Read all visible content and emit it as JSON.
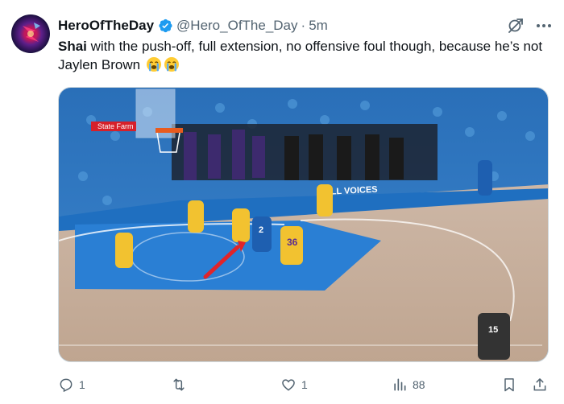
{
  "tweet": {
    "author": {
      "display_name": "HeroOfTheDay",
      "handle": "@Hero_OfThe_Day",
      "verified": true,
      "verified_color": "#1d9bf0"
    },
    "separator": "·",
    "time": "5m",
    "text_bold": "Shai",
    "text_rest": " with the push-off, full extension, no offensive foul though, because he’s not Jaylen Brown",
    "emojis": [
      "loudly-crying-face",
      "loudly-crying-face"
    ],
    "media": {
      "alt": "",
      "scene": {
        "tables_banner": "State Farm",
        "court_text": "ALL VOICES",
        "jersey_numbers": [
          "2",
          "36",
          "15"
        ]
      }
    },
    "actions": {
      "reply_count": "1",
      "retweet_count": "",
      "like_count": "1",
      "views_count": "88"
    },
    "icons": [
      "grok-icon",
      "more-icon",
      "reply-icon",
      "retweet-icon",
      "like-icon",
      "views-icon",
      "bookmark-icon",
      "share-icon"
    ],
    "colors": {
      "text": "#0f1419",
      "secondary": "#536471",
      "accent": "#1d9bf0"
    }
  }
}
